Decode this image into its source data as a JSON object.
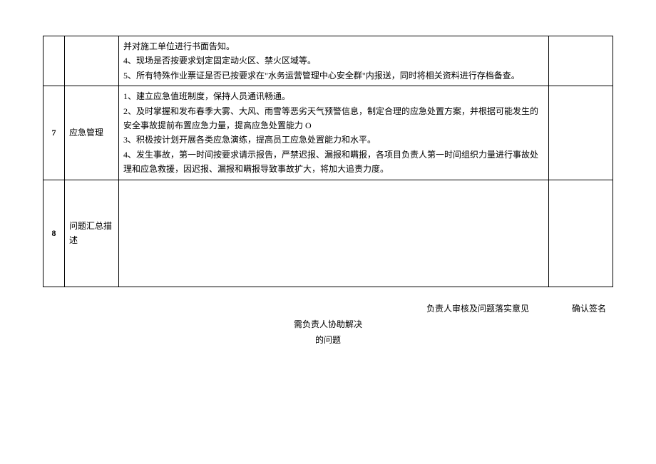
{
  "rows": {
    "r6": {
      "content": "并对施工单位进行书面告知。\n4、现场是否按要求划定固定动火区、禁火区域等。\n5、所有特殊作业票证是否已按要求在\"水务运营管理中心安全群\"内报送，同时将相关资料进行存档备查。"
    },
    "r7": {
      "num": "7",
      "title": "应急管理",
      "content": "1、建立应急值班制度，保持人员通讯畅通。\n2、及时掌握和发布春季大雾、大风、雨雪等恶劣天气预警信息，制定合理的应急处置方案，并根据可能发生的安全事故提前布置应急力量，提高应急处置能力 O\n3、积极按计划开展各类应急演练，提高员工应急处置能力和水平。\n4、发生事故，第一时间按要求请示报告，严禁迟报、漏报和瞒报，各项目负责人第一时间组织力量进行事故处理和应急救援，因迟报、漏报和瞒报导致事故扩大，将加大追责力度。"
    },
    "r8": {
      "num": "8",
      "title": "问题汇总描述",
      "content": ""
    }
  },
  "footer": {
    "review": "负责人审核及问题落实意见",
    "sign": "确认签名",
    "assist1": "需负责人协助解决",
    "assist2": "的问题"
  }
}
